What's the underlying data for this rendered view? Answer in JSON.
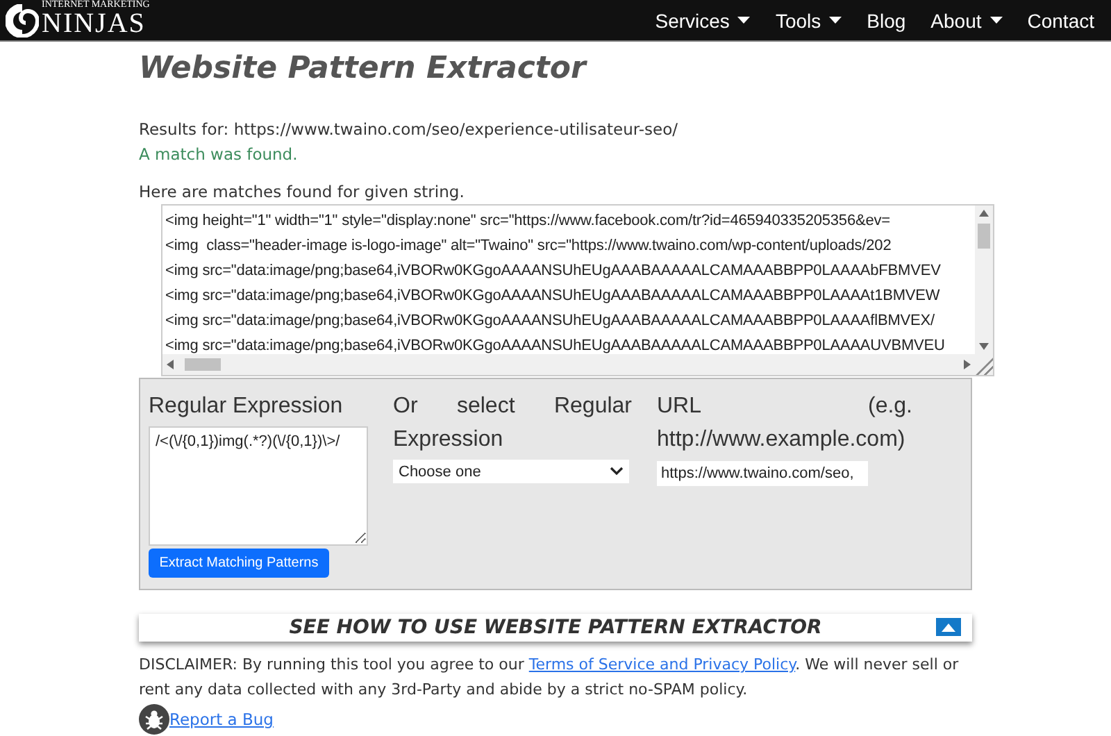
{
  "header": {
    "logo": {
      "tagline": "INTERNET MARKETING",
      "name": "NINJAS"
    },
    "nav": [
      {
        "label": "Services",
        "has_menu": true
      },
      {
        "label": "Tools",
        "has_menu": true
      },
      {
        "label": "Blog",
        "has_menu": false
      },
      {
        "label": "About",
        "has_menu": true
      },
      {
        "label": "Contact",
        "has_menu": false
      }
    ]
  },
  "title": "Website Pattern Extractor",
  "results_for": "Results for: https://www.twaino.com/seo/experience-utilisateur-seo/",
  "match_status": "A match was found.",
  "matches_heading": "Here are matches found for given string.",
  "matches": [
    "<img height=\"1\" width=\"1\" style=\"display:none\" src=\"https://www.facebook.com/tr?id=465940335205356&ev=",
    "<img  class=\"header-image is-logo-image\" alt=\"Twaino\" src=\"https://www.twaino.com/wp-content/uploads/202",
    "<img src=\"data:image/png;base64,iVBORw0KGgoAAAANSUhEUgAAABAAAAALCAMAAABBPP0LAAAAbFBMVEV",
    "<img src=\"data:image/png;base64,iVBORw0KGgoAAAANSUhEUgAAABAAAAALCAMAAABBPP0LAAAAt1BMVEW",
    "<img src=\"data:image/png;base64,iVBORw0KGgoAAAANSUhEUgAAABAAAAALCAMAAABBPP0LAAAAflBMVEX/",
    "<img src=\"data:image/png;base64,iVBORw0KGgoAAAANSUhEUgAAABAAAAALCAMAAABBPP0LAAAAUVBMVEU"
  ],
  "form": {
    "regex_label": "Regular Expression",
    "regex_value": "/<(\\/{0,1})img(.*?)(\\/{0,1})\\>/",
    "select_label": "Or select Regular Expression",
    "select_value": "Choose one",
    "url_label": "URL (e.g. http://www.example.com)",
    "url_value": "https://www.twaino.com/seo,",
    "submit": "Extract Matching Patterns"
  },
  "howto": {
    "title": "SEE HOW TO USE WEBSITE PATTERN EXTRACTOR",
    "expanded": false
  },
  "disclaimer": {
    "before": "DISCLAIMER: By running this tool you agree to our ",
    "link": "Terms of Service and Privacy Policy",
    "after": ". We will never sell or rent any data collected with any 3rd-Party and abide by a strict no-SPAM policy."
  },
  "report_bug": "Report a Bug"
}
